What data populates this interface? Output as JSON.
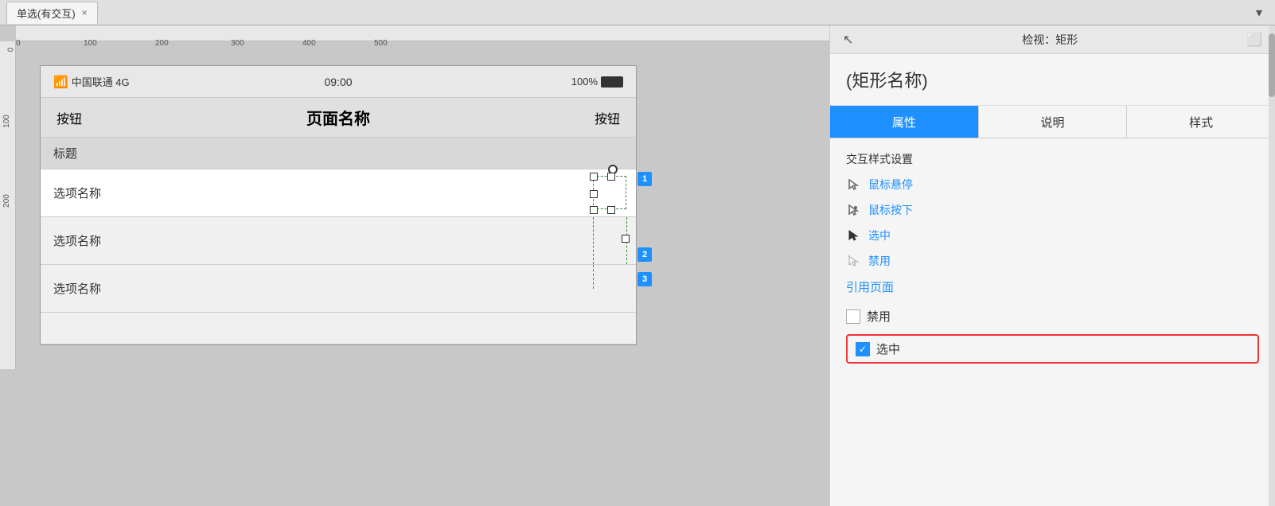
{
  "tab": {
    "label": "单选(有交互)",
    "close_icon": "×"
  },
  "dropdown_icon": "▾",
  "canvas": {
    "ruler_top_marks": [
      "0",
      "100",
      "200",
      "300",
      "400",
      "500"
    ],
    "ruler_left_marks": [
      "0",
      "100",
      "200"
    ],
    "status_bar": {
      "signal": "📶",
      "carrier": "中国联通 4G",
      "time": "09:00",
      "battery_pct": "100%"
    },
    "nav_bar": {
      "left_btn": "按钮",
      "title": "页面名称",
      "right_btn": "按钮"
    },
    "section_header": "标题",
    "list_items": [
      {
        "label": "选项名称",
        "selected": true
      },
      {
        "label": "选项名称",
        "selected": false
      },
      {
        "label": "选项名称",
        "selected": false
      }
    ],
    "handle_labels": [
      "1",
      "2",
      "3"
    ]
  },
  "right_panel": {
    "header_title": "检视：矩形",
    "shape_name": "(矩形名称)",
    "tabs": [
      "属性",
      "说明",
      "样式"
    ],
    "active_tab": "属性",
    "section_title": "交互样式设置",
    "interactions": [
      {
        "label": "鼠标悬停"
      },
      {
        "label": "鼠标按下"
      },
      {
        "label": "选中"
      },
      {
        "label": "禁用"
      }
    ],
    "ref_page_label": "引用页面",
    "disabled_checkbox": {
      "label": "禁用",
      "checked": false
    },
    "selected_checkbox": {
      "label": "选中",
      "checked": true
    }
  }
}
